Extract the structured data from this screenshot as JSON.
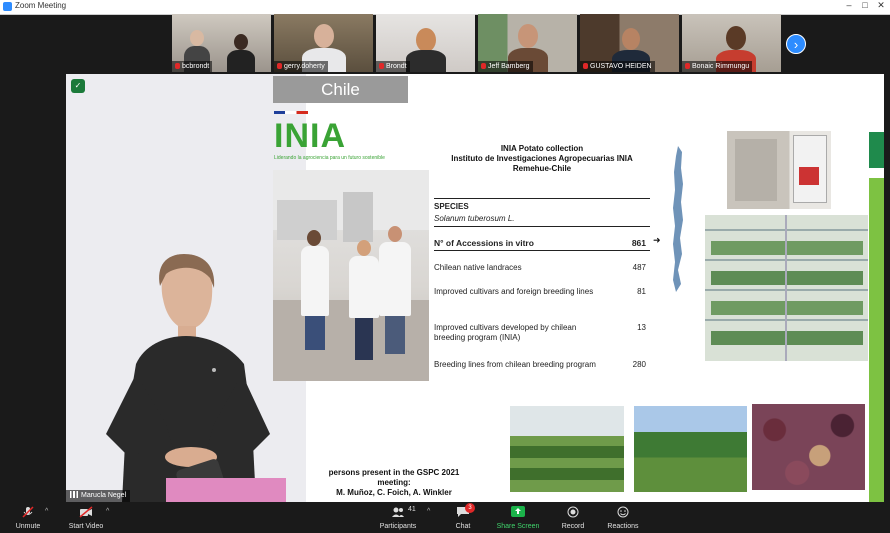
{
  "window": {
    "title": "Zoom Meeting",
    "controls": [
      "–",
      "□",
      "✕"
    ]
  },
  "participants_strip": [
    {
      "name": "bcbrondt",
      "muted": true
    },
    {
      "name": "gerry.doherty",
      "muted": true
    },
    {
      "name": "Brondt",
      "muted": true
    },
    {
      "name": "Jeff Bamberg",
      "muted": true
    },
    {
      "name": "GUSTAVO HEIDEN",
      "muted": true
    },
    {
      "name": "Bonaic Rimmungu",
      "muted": true
    }
  ],
  "next_icon": "chevron-right-icon",
  "shared_screen": {
    "presenter_name": "Marucla Negel",
    "slide": {
      "country": "Chile",
      "logo_text": "INIA",
      "logo_tagline": "Liderando la agrociencia para un futuro sostenible",
      "heading_lines": [
        "INIA Potato collection",
        "Instituto de Investigaciones Agropecuarias INIA",
        "Remehue-Chile"
      ],
      "species_label": "SPECIES",
      "species_name": "Solanum tuberosum L.",
      "accessions_label": "N° of Accessions in vitro",
      "accessions_value": "861",
      "rows": [
        {
          "label": "Chilean native landraces",
          "value": "487"
        },
        {
          "label": "Improved cultivars and foreign breeding lines",
          "value": "81"
        },
        {
          "label": "Improved cultivars developed by chilean breeding program (INIA)",
          "value": "13"
        },
        {
          "label": "Breeding lines from chilean breeding program",
          "value": "280"
        }
      ],
      "attribution_lines": [
        "persons present in the GSPC 2021",
        "meeting:",
        "M. Muñoz, C. Foich, A. Winkler"
      ]
    }
  },
  "toolbar": {
    "unmute": "Unmute",
    "start_video": "Start Video",
    "participants": "Participants",
    "participants_count": "41",
    "chat": "Chat",
    "chat_badge": "3",
    "share_screen": "Share Screen",
    "record": "Record",
    "reactions": "Reactions"
  },
  "colors": {
    "accent": "#2d8cff",
    "share_green": "#1bb34a",
    "inia_green": "#3aa335",
    "mute_red": "#e02828"
  }
}
